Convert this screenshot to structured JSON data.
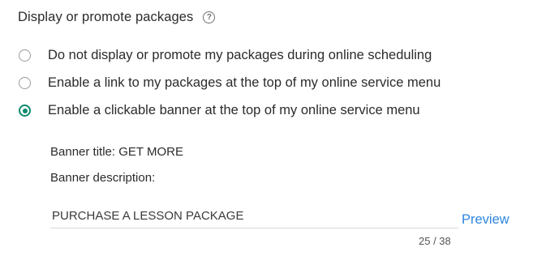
{
  "header": {
    "title": "Display or promote packages",
    "help_icon": "question-circle-icon",
    "help_glyph": "?"
  },
  "options": [
    {
      "label": "Do not display or promote my packages during online scheduling",
      "selected": false
    },
    {
      "label": "Enable a link to my packages at the top of my online service menu",
      "selected": false
    },
    {
      "label": "Enable a clickable banner at the top of my online service menu",
      "selected": true
    }
  ],
  "banner": {
    "title_label": "Banner title:",
    "title_value": "GET MORE",
    "description_label": "Banner description:",
    "description_value": "PURCHASE A LESSON PACKAGE",
    "char_count": "25 / 38",
    "preview_label": "Preview"
  },
  "colors": {
    "accent_green": "#0f8a6e",
    "link_blue": "#2e86de"
  }
}
